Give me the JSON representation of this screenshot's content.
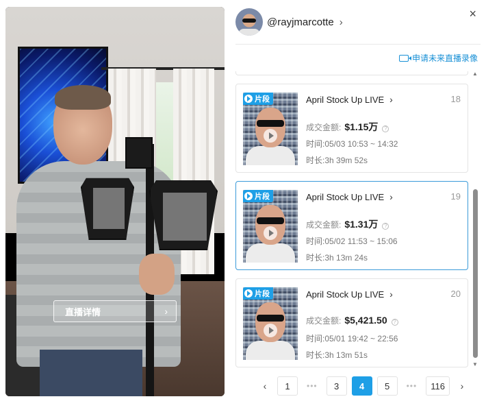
{
  "video": {
    "detail_button_label": "直播详情",
    "detail_button_icon": "chevron-right-icon"
  },
  "profile": {
    "username": "@rayjmarcotte",
    "chevron": "›"
  },
  "close_label": "×",
  "request_link": {
    "label": "申请未来直播录像",
    "icon": "video-camera-icon",
    "color": "#1890d6"
  },
  "badge_label": "片段",
  "accent_color": "#1e9fe6",
  "cards": [
    {
      "title": "April Stock Up LIVE",
      "chevron": "›",
      "number": "18",
      "amount_label": "成交金额:",
      "amount_value": "$1.15万",
      "time": "时间:05/03 10:53 ~ 14:32",
      "duration": "时长:3h 39m 52s",
      "selected": false
    },
    {
      "title": "April Stock Up LIVE",
      "chevron": "›",
      "number": "19",
      "amount_label": "成交金额:",
      "amount_value": "$1.31万",
      "time": "时间:05/02 11:53 ~ 15:06",
      "duration": "时长:3h 13m 24s",
      "selected": true
    },
    {
      "title": "April Stock Up LIVE",
      "chevron": "›",
      "number": "20",
      "amount_label": "成交金额:",
      "amount_value": "$5,421.50",
      "time": "时间:05/01 19:42 ~ 22:56",
      "duration": "时长:3h 13m 51s",
      "selected": false
    }
  ],
  "pagination": {
    "prev": "‹",
    "first": "1",
    "ellipsis": "•••",
    "pages": [
      "3",
      "4",
      "5"
    ],
    "current": "4",
    "last": "116",
    "next": "›"
  }
}
